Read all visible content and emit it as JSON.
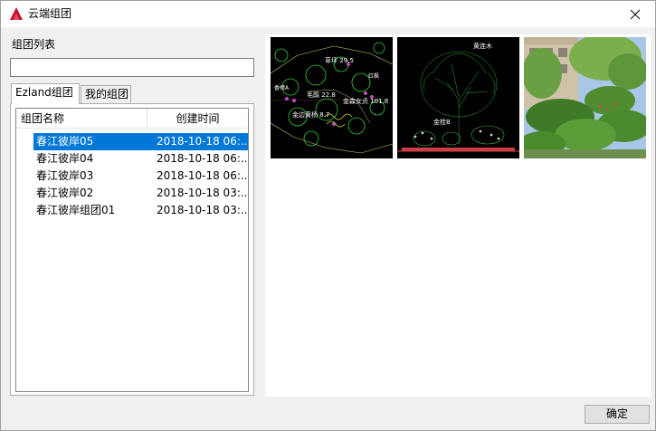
{
  "window": {
    "title": "云端组团",
    "icon": "autocad-a-icon",
    "accent": "#c8102e"
  },
  "left": {
    "list_label": "组团列表",
    "search_value": "",
    "tabs": [
      {
        "label": "Ezland组团",
        "active": true
      },
      {
        "label": "我的组团",
        "active": false
      }
    ],
    "columns": {
      "name": "组团名称",
      "time": "创建时间"
    },
    "rows": [
      {
        "name": "春江彼岸05",
        "time": "2018-10-18 06:...",
        "selected": true
      },
      {
        "name": "春江彼岸04",
        "time": "2018-10-18 06:...",
        "selected": false
      },
      {
        "name": "春江彼岸03",
        "time": "2018-10-18 06:...",
        "selected": false
      },
      {
        "name": "春江彼岸02",
        "time": "2018-10-18 03:...",
        "selected": false
      },
      {
        "name": "春江彼岸组团01",
        "time": "2018-10-18 03:...",
        "selected": false
      }
    ],
    "selection_color": "#0078d7"
  },
  "preview": {
    "plan_labels": [
      "草坪 29.5",
      "毛鹃 22.8",
      "金森女贞 101.8",
      "金边黄杨 8.7",
      "香樟A",
      "红枫"
    ],
    "elevation_label": "黄连木",
    "elevation_sub": "金桂B"
  },
  "footer": {
    "ok_label": "确定"
  }
}
